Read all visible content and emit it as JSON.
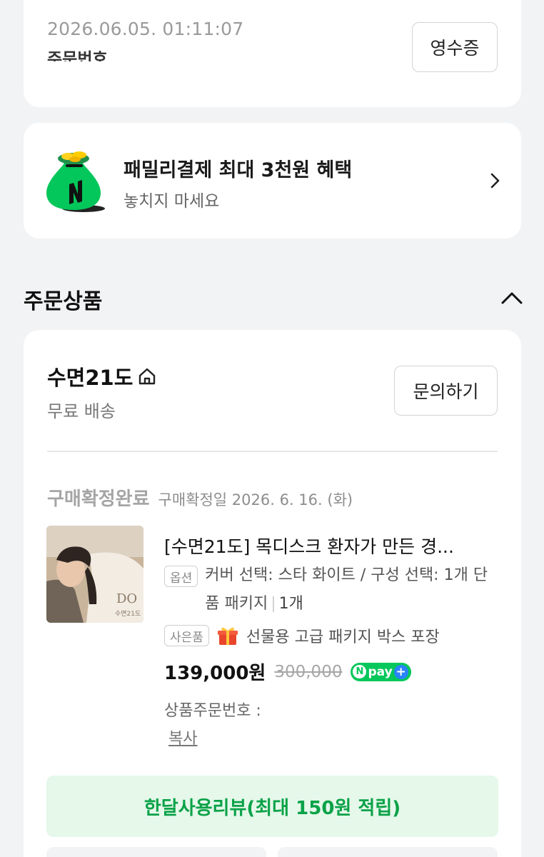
{
  "order_header": {
    "timestamp": "2026.06.05. 01:11:07",
    "order_number_label": "주문번호 ",
    "receipt_button": "영수증"
  },
  "promo": {
    "title": "패밀리결제 최대 3천원 혜택",
    "subtitle": "놓치지 마세요",
    "icon": "money-bag-icon"
  },
  "section": {
    "title": "주문상품",
    "toggle_icon": "chevron-up-icon"
  },
  "seller": {
    "name": "수면21도",
    "shipping": "무료 배송",
    "inquiry_button": "문의하기"
  },
  "order_item": {
    "status": "구매확정완료",
    "confirm_date": "구매확정일 2026. 6. 16. (화)",
    "product_name": "[수면21도] 목디스크 환자가 만든 경...",
    "option_tag": "옵션",
    "option_text": "커버 선택: 스타 화이트 / 구성 선택: 1개 단품 패키지",
    "quantity": "1개",
    "gift_tag": "사은품",
    "gift_text": "선물용 고급 패키지 박스 포장",
    "price": "139,000원",
    "original_price": "300,000",
    "npay_label": "pay",
    "product_order_number_label": "상품주문번호 : ",
    "copy_link": "복사",
    "thumbnail_brand": "DO",
    "thumbnail_sub": "수면21도"
  },
  "review_button": "한달사용리뷰(최대 150원 적립)",
  "colors": {
    "accent_green": "#03c75a",
    "review_bg": "#e5f8ea",
    "review_text": "#0aa248",
    "npay_plus": "#2a83ff"
  }
}
